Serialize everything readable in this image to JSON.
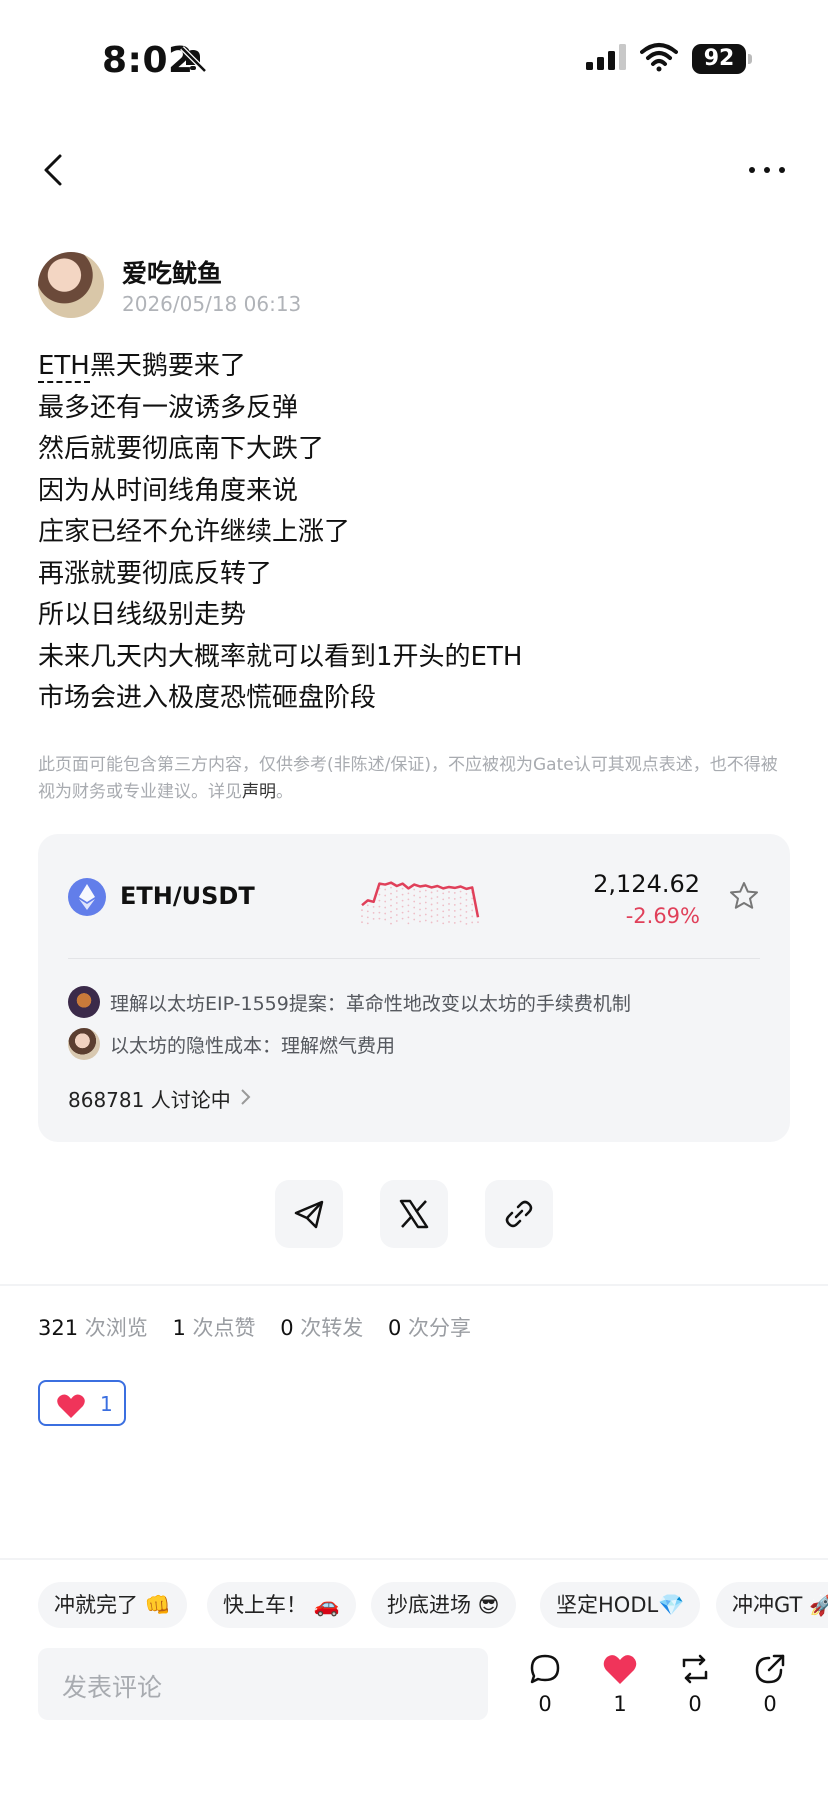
{
  "status": {
    "time": "8:02",
    "battery": "92"
  },
  "author": {
    "name": "爱吃鱿鱼",
    "date": "2026/05/18 06:13"
  },
  "post": {
    "first_line_link": "ETH",
    "first_line_rest": "黑天鹅要来了",
    "lines": [
      "最多还有一波诱多反弹",
      "然后就要彻底南下大跌了",
      "因为从时间线角度来说",
      "庄家已经不允许继续上涨了",
      "再涨就要彻底反转了",
      "所以日线级别走势",
      "未来几天内大概率就可以看到1开头的ETH",
      "市场会进入极度恐慌砸盘阶段"
    ]
  },
  "disclaimer": {
    "text": "此页面可能包含第三方内容，仅供参考(非陈述/保证)，不应被视为Gate认可其观点表述，也不得被视为财务或专业建议。详见",
    "link": "声明",
    "end": "。"
  },
  "market_card": {
    "pair": "ETH/USDT",
    "price": "2,124.62",
    "change": "-2.69%",
    "topics": [
      "理解以太坊EIP-1559提案：革命性地改变以太坊的手续费机制",
      "以太坊的隐性成本：理解燃气费用"
    ],
    "discussion": "868781 人讨论中",
    "sparkline": [
      0.35,
      0.45,
      0.42,
      0.8,
      0.78,
      0.82,
      0.75,
      0.8,
      0.7,
      0.78,
      0.74,
      0.76,
      0.72,
      0.75,
      0.7,
      0.73,
      0.71,
      0.74,
      0.69,
      0.72,
      0.1
    ],
    "sparkline_color": "#e0405a"
  },
  "stats": [
    {
      "n": "321",
      "label": "次浏览"
    },
    {
      "n": "1",
      "label": "次点赞"
    },
    {
      "n": "0",
      "label": "次转发"
    },
    {
      "n": "0",
      "label": "次分享"
    }
  ],
  "like_chip": {
    "count": "1"
  },
  "quick_replies": [
    "冲就完了 👊",
    "快上车！ 🚗",
    "抄底进场 😎",
    "坚定HODL💎",
    "冲冲GT 🚀"
  ],
  "comment": {
    "placeholder": "发表评论",
    "actions": [
      {
        "name": "comment",
        "count": "0"
      },
      {
        "name": "like",
        "count": "1"
      },
      {
        "name": "repost",
        "count": "0"
      },
      {
        "name": "share",
        "count": "0"
      }
    ]
  },
  "colors": {
    "accent": "#3b6fe0",
    "down": "#e0405a",
    "heart": "#f0345a"
  }
}
